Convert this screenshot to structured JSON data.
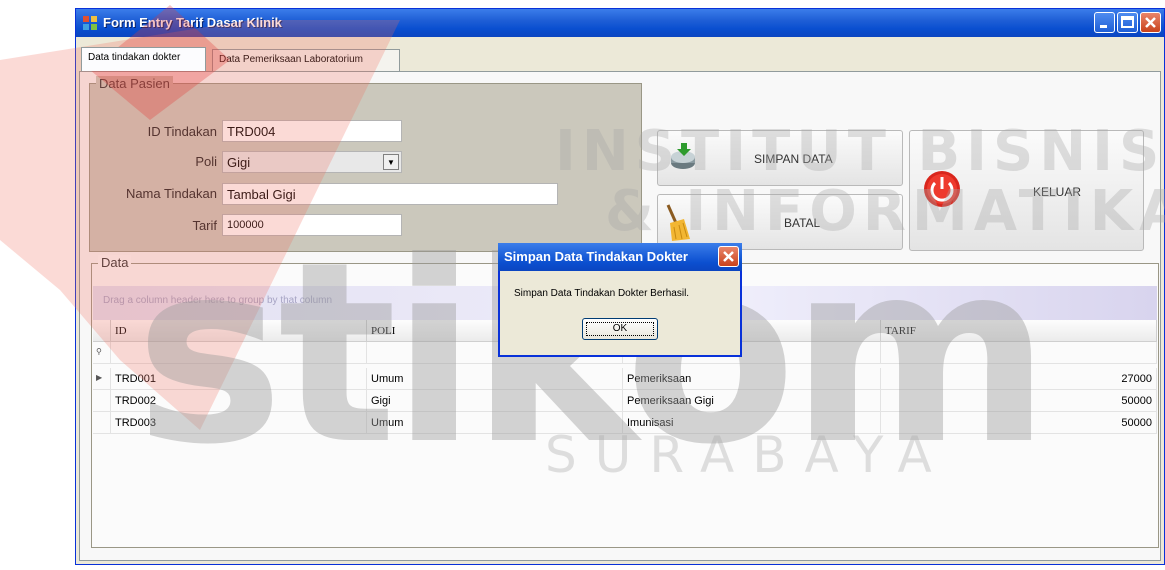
{
  "window": {
    "title": "Form Entry Tarif Dasar Klinik"
  },
  "tabs": [
    {
      "label": "Data tindakan dokter",
      "active": true
    },
    {
      "label": "Data Pemeriksaan Laboratorium",
      "active": false
    }
  ],
  "form": {
    "group_title": "Data Pasien",
    "id_label": "ID Tindakan",
    "id_value": "TRD004",
    "poli_label": "Poli",
    "poli_value": "Gigi",
    "nama_label": "Nama Tindakan",
    "nama_value": "Tambal Gigi",
    "tarif_label": "Tarif",
    "tarif_value": "100000"
  },
  "buttons": {
    "simpan": "SIMPAN DATA",
    "batal": "BATAL",
    "keluar": "KELUAR"
  },
  "grid": {
    "group_title": "Data",
    "drag_hint": "Drag a column header here to group by that column",
    "columns": [
      "ID",
      "POLI",
      "",
      "TARIF"
    ],
    "rows": [
      {
        "id": "TRD001",
        "poli": "Umum",
        "nama": "Pemeriksaan",
        "tarif": "27000"
      },
      {
        "id": "TRD002",
        "poli": "Gigi",
        "nama": "Pemeriksaan Gigi",
        "tarif": "50000"
      },
      {
        "id": "TRD003",
        "poli": "Umum",
        "nama": "Imunisasi",
        "tarif": "50000"
      }
    ]
  },
  "dialog": {
    "title": "Simpan Data Tindakan Dokter",
    "message": "Simpan Data Tindakan Dokter Berhasil.",
    "ok": "OK"
  },
  "watermark": {
    "line1": "INSTITUT BISNIS",
    "line2": "& INFORMATIKA",
    "logo": "stikom",
    "line3": "SURABAYA"
  },
  "colors": {
    "titlebar": "#0a4fd0",
    "group_bg": "#cbc8bc",
    "logo_red": "#e53935"
  }
}
